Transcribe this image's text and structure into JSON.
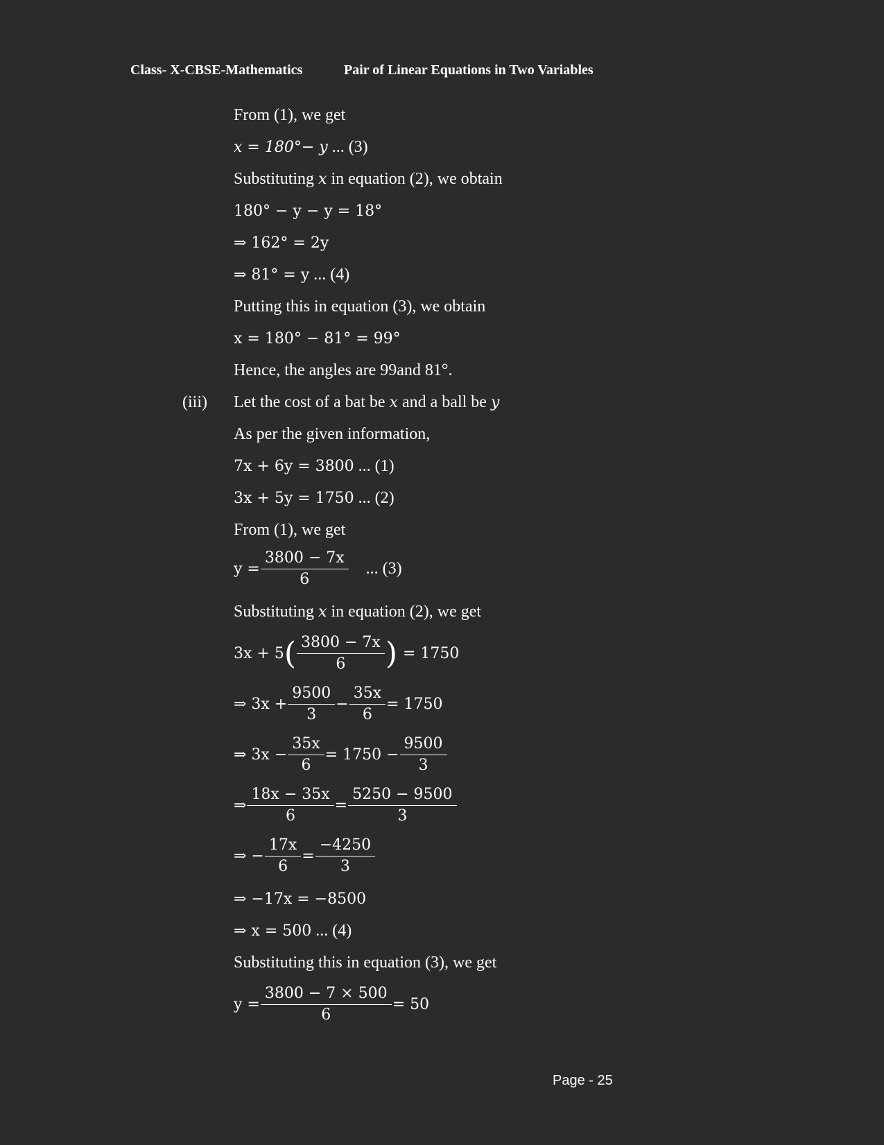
{
  "header": {
    "left": "Class- X-CBSE-Mathematics",
    "right": "Pair of Linear Equations in Two Variables"
  },
  "lines": {
    "l1": "From (1), we get",
    "l2": "x = 180°− y",
    "l2b": " ... (3)",
    "l3a": "Substituting ",
    "l3x": "x",
    "l3b": " in equation (2), we obtain",
    "l4": "180° − y − y = 18°",
    "l5": "⇒ 162° = 2y",
    "l6": "⇒ 81° = y",
    "l6b": "   ... (4)",
    "l7": "Putting this in equation (3), we obtain",
    "l8": "x = 180° − 81° = 99°",
    "l9": "Hence, the angles are 99and 81°.",
    "iii_label": "(iii)",
    "l10a": "Let the cost of a bat be ",
    "l10x": "x",
    "l10b": " and a ball be ",
    "l10y": "y",
    "l11": "As per the given information,",
    "l12": "7x + 6y = 3800",
    "l12b": "   ... (1)",
    "l13": "3x + 5y = 1750",
    "l13b": " ... (2)",
    "l14": "From (1), we get",
    "l15_lhs": "y =",
    "l15_num": "3800 − 7x",
    "l15_den": "6",
    "l15_tag": "... (3)",
    "l16a": "Substituting ",
    "l16x": "x",
    "l16b": " in equation (2), we get",
    "l17_lhs": "3x + 5",
    "l17_num": "3800 − 7x",
    "l17_den": "6",
    "l17_rhs": "= 1750",
    "l18_lhs": "⇒ 3x +",
    "l18_n1": "9500",
    "l18_d1": "3",
    "l18_minus": "−",
    "l18_n2": "35x",
    "l18_d2": "6",
    "l18_rhs": "= 1750",
    "l19_lhs": "⇒ 3x −",
    "l19_n1": "35x",
    "l19_d1": "6",
    "l19_mid": "= 1750 −",
    "l19_n2": "9500",
    "l19_d2": "3",
    "l20_lhs": "⇒",
    "l20_n1": "18x − 35x",
    "l20_d1": "6",
    "l20_mid": "=",
    "l20_n2": "5250 − 9500",
    "l20_d2": "3",
    "l21_lhs": "⇒ −",
    "l21_n1": "17x",
    "l21_d1": "6",
    "l21_mid": "=",
    "l21_n2": "−4250",
    "l21_d2": "3",
    "l22": "⇒ −17x = −8500",
    "l23": "⇒ x = 500",
    "l23b": " ... (4)",
    "l24": "Substituting this in equation (3), we get",
    "l25_lhs": "y =",
    "l25_num": "3800 − 7 × 500",
    "l25_den": "6",
    "l25_rhs": "= 50"
  },
  "footer": {
    "page": "Page - 25"
  }
}
